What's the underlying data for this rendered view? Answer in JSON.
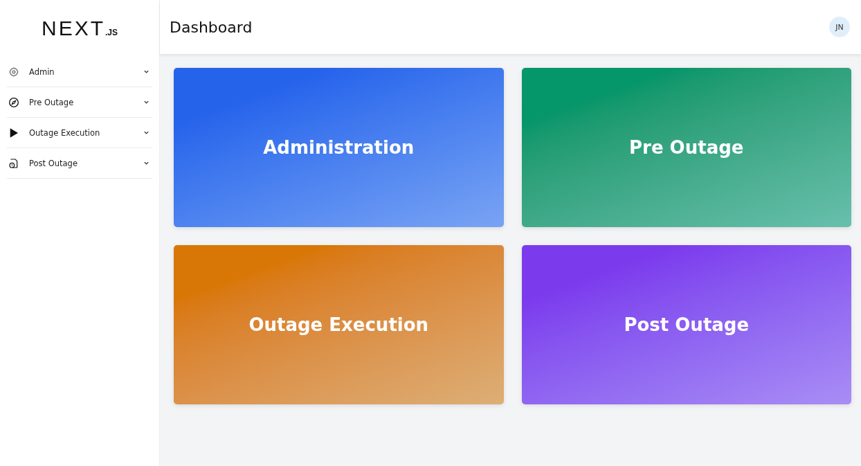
{
  "logo": {
    "word": "NEXT",
    "suffix": ".JS"
  },
  "sidebar": {
    "items": [
      {
        "label": "Admin",
        "expanded": false
      },
      {
        "label": "Pre Outage",
        "expanded": false
      },
      {
        "label": "Outage Execution",
        "expanded": false
      },
      {
        "label": "Post Outage",
        "expanded": false
      }
    ]
  },
  "header": {
    "title": "Dashboard",
    "avatar": "JN"
  },
  "cards": [
    {
      "title": "Administration",
      "color": "#2563eb"
    },
    {
      "title": "Pre Outage",
      "color": "#059669"
    },
    {
      "title": "Outage Execution",
      "color": "#d97706"
    },
    {
      "title": "Post Outage",
      "color": "#7c3aed"
    }
  ]
}
